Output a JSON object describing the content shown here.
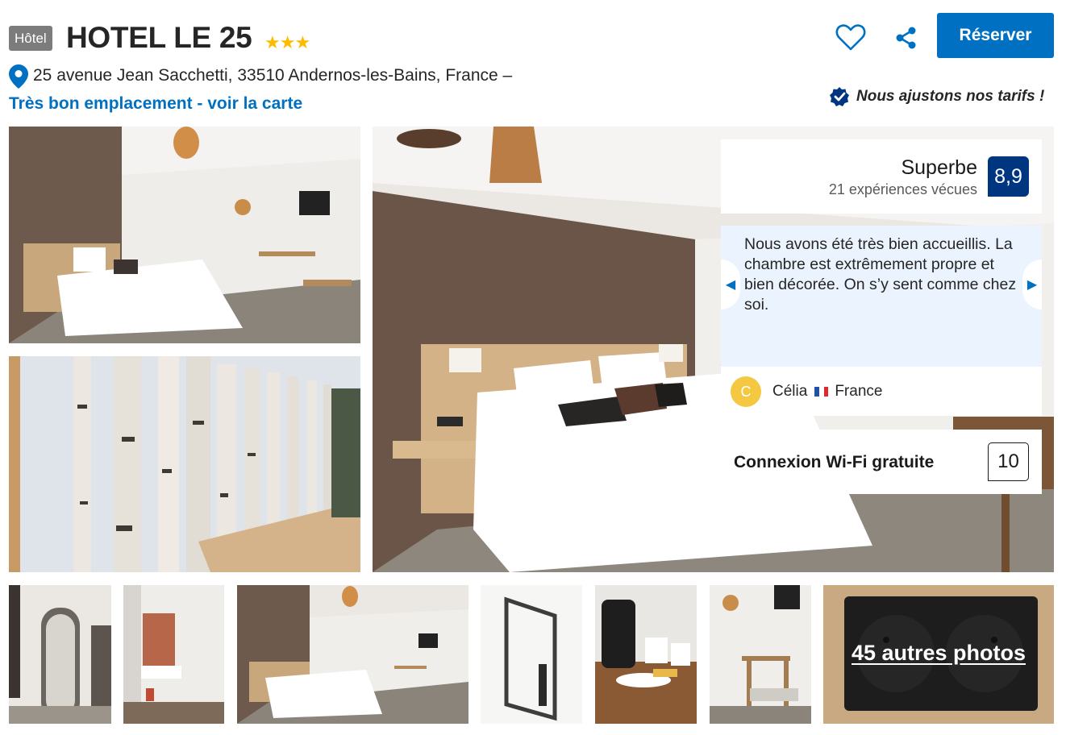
{
  "header": {
    "badge": "Hôtel",
    "name": "HOTEL LE 25",
    "stars": "★★★",
    "address": "25 avenue Jean Sacchetti, 33510 Andernos-les-Bains, France –",
    "map_link": "Très bon emplacement - voir la carte"
  },
  "actions": {
    "reserve_label": "Réserver",
    "price_match": "Nous ajustons nos tarifs !"
  },
  "score": {
    "label": "Superbe",
    "count": "21 expériences vécues",
    "value": "8,9"
  },
  "review": {
    "text": "Nous avons été très bien accueillis. La chambre est extrêmement propre et bien décorée. On s’y sent comme chez soi.",
    "avatar_letter": "C",
    "name": "Célia",
    "country": "France"
  },
  "wifi": {
    "label": "Connexion Wi-Fi gratuite",
    "score": "10"
  },
  "gallery": {
    "more_photos": "45 autres photos"
  },
  "colors": {
    "brand_blue": "#0071c2",
    "score_blue": "#003580",
    "review_bg": "#ebf3ff",
    "star_yellow": "#febb02"
  }
}
